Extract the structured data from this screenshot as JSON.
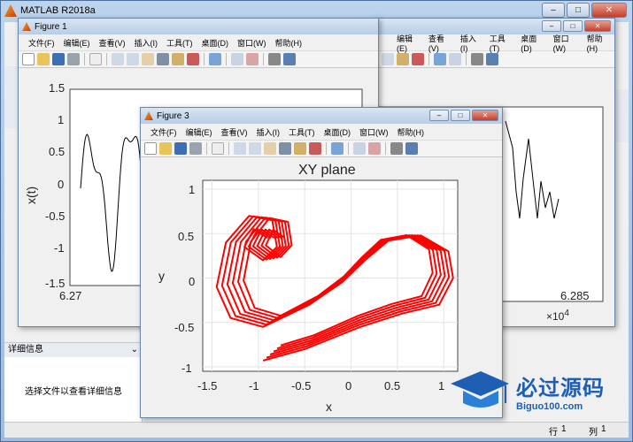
{
  "app": {
    "title": "MATLAB R2018a"
  },
  "details": {
    "header": "详细信息",
    "placeholder": "选择文件以查看详细信息"
  },
  "statusbar": {
    "row_label": "行",
    "row_value": "1",
    "col_label": "列",
    "col_value": "1"
  },
  "menus": [
    "文件(F)",
    "编辑(E)",
    "查看(V)",
    "插入(I)",
    "工具(T)",
    "桌面(D)",
    "窗口(W)",
    "帮助(H)"
  ],
  "figure1": {
    "title": "Figure 1",
    "ylabel": "x(t)",
    "yticks": [
      "1.5",
      "1",
      "0.5",
      "0",
      "-0.5",
      "-1",
      "-1.5"
    ],
    "xtick_left": "6.27",
    "xtick_right": "6.285",
    "exponent": "×10",
    "exponent_power": "4"
  },
  "figure3": {
    "title": "Figure 3",
    "plot_title": "XY plane",
    "xlabel": "x",
    "ylabel": "y",
    "xticks": [
      "-1.5",
      "-1",
      "-0.5",
      "0",
      "0.5",
      "1"
    ],
    "yticks": [
      "1",
      "0.5",
      "0",
      "-0.5",
      "-1"
    ]
  },
  "watermark": {
    "line1": "必过源码",
    "line2": "Biguo100.com"
  },
  "colors": {
    "trajectory": "#ff0000",
    "timeseries": "#000000"
  }
}
